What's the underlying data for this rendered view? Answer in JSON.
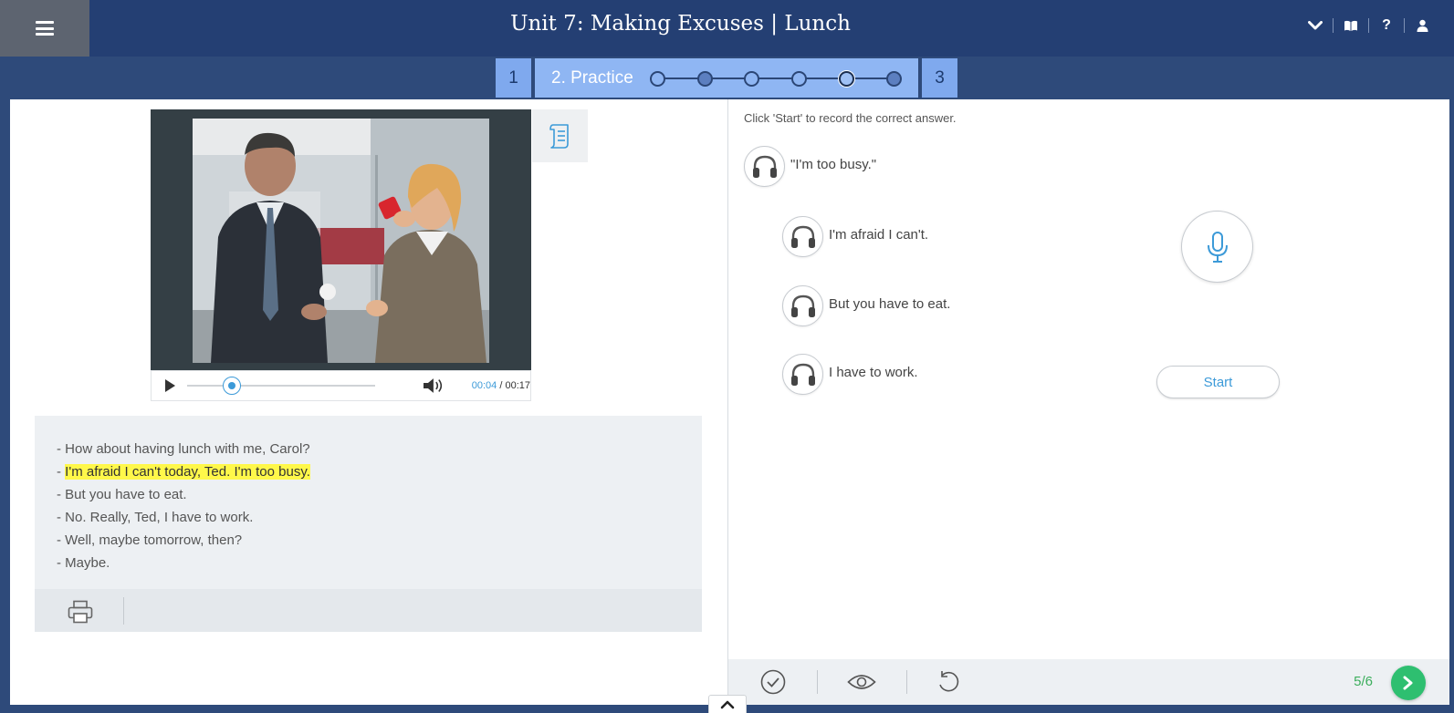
{
  "header": {
    "title": "Unit 7: Making Excuses | Lunch",
    "icons": [
      "menu-icon",
      "chevron-down-icon",
      "book-icon",
      "help-icon",
      "user-icon"
    ],
    "help_label": "?"
  },
  "steps": {
    "prev": "1",
    "active_label": "2. Practice",
    "next": "3",
    "total_tasks": 6,
    "current_task": 5
  },
  "video": {
    "current_time": "00:04",
    "duration": "00:17",
    "progress": 0.235,
    "separator": " / "
  },
  "dialogue": [
    {
      "text": "- How about having lunch with me, Carol?",
      "highlight": false
    },
    {
      "text": "- ",
      "highlight_text": "I'm afraid I can't today, Ted. I'm too busy.",
      "highlight": true
    },
    {
      "text": "- But you have to eat.",
      "highlight": false
    },
    {
      "text": "- No. Really, Ted, I have to work.",
      "highlight": false
    },
    {
      "text": "- Well, maybe tomorrow, then?",
      "highlight": false
    },
    {
      "text": "- Maybe.",
      "highlight": false
    }
  ],
  "exercise": {
    "instruction": "Click 'Start' to record the correct answer.",
    "prompt": "\"I'm too busy.\"",
    "options": [
      "I'm afraid I can't.",
      "But you have to eat.",
      "I have to work."
    ],
    "start_label": "Start"
  },
  "footer": {
    "counter": "5/6"
  },
  "colors": {
    "header_bg": "#243f73",
    "accent": "#3c9ad8",
    "highlight": "#fff84a",
    "next_green": "#2ebf70"
  }
}
